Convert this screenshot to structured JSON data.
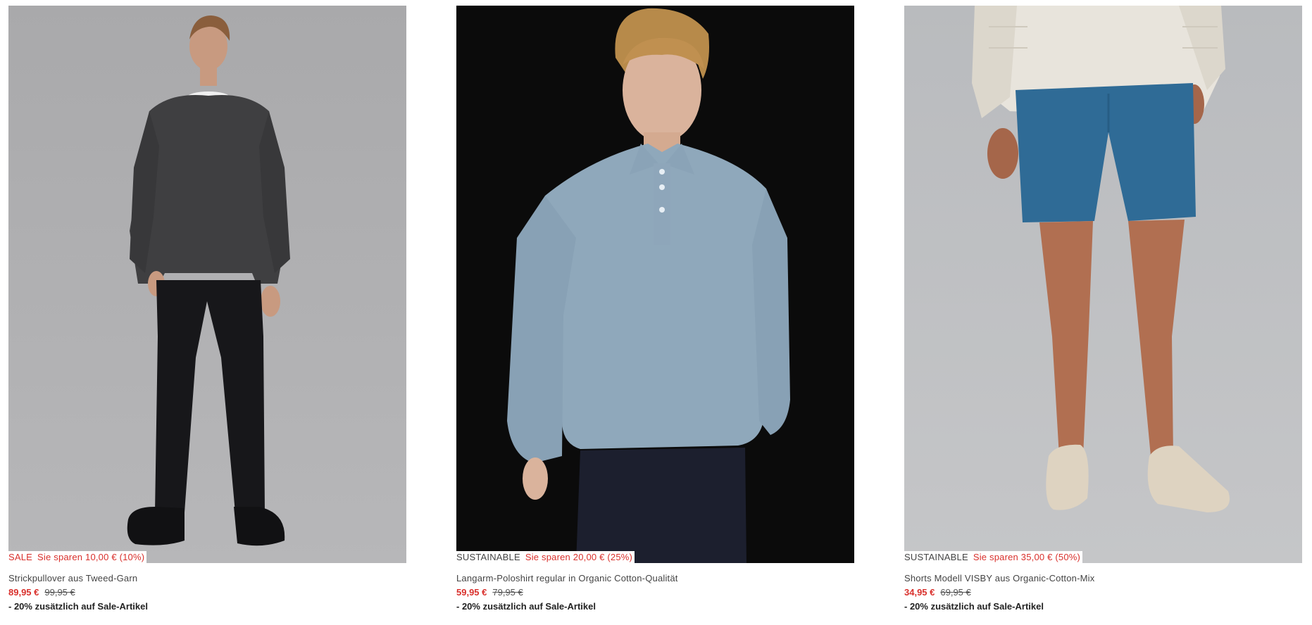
{
  "products": [
    {
      "image": "model-grey-tweed-sweater-black-jeans",
      "flag": "SALE",
      "savings": "Sie sparen 10,00 € (10%)",
      "title": "Strickpullover aus Tweed-Garn",
      "price": "89,95 €",
      "old_price": "99,95 €",
      "promo": "- 20% zusätzlich auf Sale-Artikel"
    },
    {
      "image": "model-light-blue-longsleeve-polo",
      "flag": "SUSTAINABLE",
      "savings": "Sie sparen 20,00 € (25%)",
      "title": "Langarm-Poloshirt regular in Organic Cotton-Qualität",
      "price": "59,95 €",
      "old_price": "79,95 €",
      "promo": "- 20% zusätzlich auf Sale-Artikel"
    },
    {
      "image": "model-blue-chino-shorts-beige-boots",
      "flag": "SUSTAINABLE",
      "savings": "Sie sparen 35,00 € (50%)",
      "title": "Shorts Modell VISBY aus Organic-Cotton-Mix",
      "price": "34,95 €",
      "old_price": "69,95 €",
      "promo": "- 20% zusätzlich auf Sale-Artikel"
    }
  ],
  "colors": {
    "sale_red": "#d9302c",
    "text": "#444444"
  }
}
